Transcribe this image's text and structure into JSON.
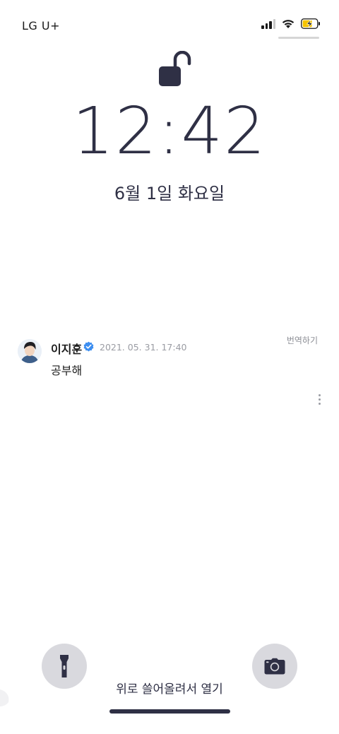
{
  "status_bar": {
    "carrier": "LG U+",
    "signal_bars_active": 3,
    "signal_bars_total": 4,
    "battery_charging": true,
    "battery_color": "#f5c400"
  },
  "lock_screen": {
    "lock_state_icon": "unlocked-padlock-icon",
    "time": "12:42",
    "date": "6월 1일 화요일"
  },
  "notification": {
    "sender": "이지훈",
    "verified_icon": "verified-badge-icon",
    "verified_color": "#3d8ef0",
    "timestamp": "2021. 05. 31. 17:40",
    "translate_label": "번역하기",
    "message": "공부해",
    "more_icon": "vertical-ellipsis-icon"
  },
  "bottom": {
    "flashlight_icon": "flashlight-icon",
    "camera_icon": "camera-icon",
    "swipe_hint": "위로 쓸어올려서 열기"
  }
}
